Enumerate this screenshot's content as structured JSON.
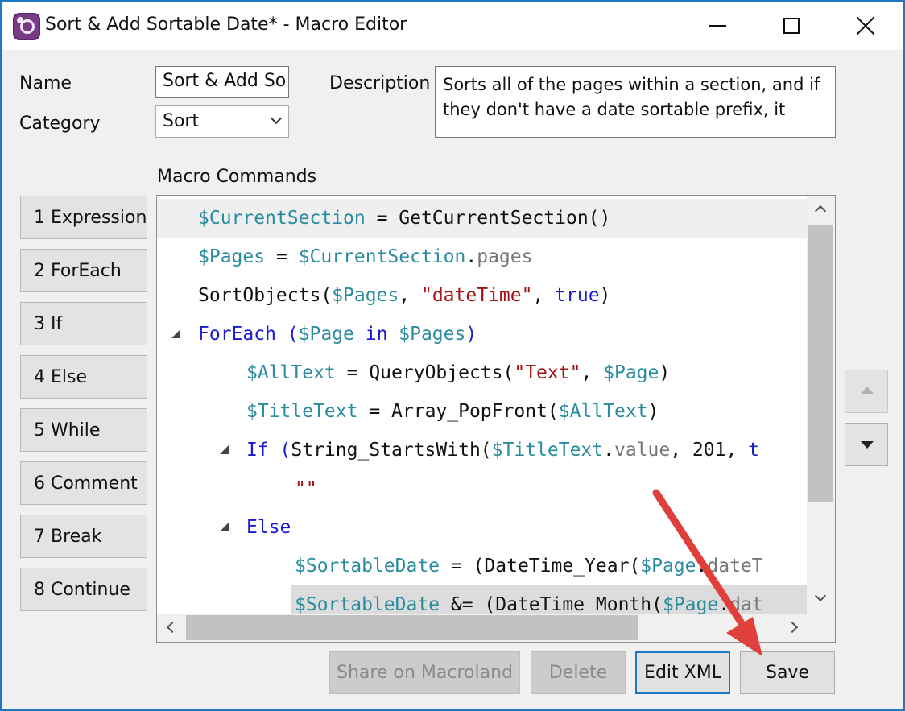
{
  "window": {
    "title": "Sort & Add Sortable Date* - Macro Editor",
    "icon": "onetastic-icon",
    "border_color": "#1e78c8"
  },
  "form": {
    "name_label": "Name",
    "name_value": "Sort & Add So",
    "category_label": "Category",
    "category_value": "Sort",
    "description_label": "Description",
    "description_value": "Sorts all of the pages within a section, and if they don't have a date sortable prefix, it",
    "commands_label": "Macro Commands"
  },
  "command_buttons": [
    "1 Expression",
    "2 ForEach",
    "3 If",
    "4 Else",
    "5 While",
    "6 Comment",
    "7 Break",
    "8 Continue"
  ],
  "code_lines": [
    {
      "indent": 0,
      "tokens": [
        [
          "v",
          "$CurrentSection"
        ],
        [
          "o",
          " = "
        ],
        [
          "f",
          "GetCurrentSection()"
        ]
      ]
    },
    {
      "indent": 0,
      "tokens": [
        [
          "v",
          "$Pages"
        ],
        [
          "o",
          " = "
        ],
        [
          "v",
          "$CurrentSection"
        ],
        [
          "o",
          "."
        ],
        [
          "p",
          "pages"
        ]
      ]
    },
    {
      "indent": 0,
      "tokens": [
        [
          "f",
          "SortObjects("
        ],
        [
          "v",
          "$Pages"
        ],
        [
          "o",
          ", "
        ],
        [
          "s",
          "\"dateTime\""
        ],
        [
          "o",
          ", "
        ],
        [
          "k",
          "true"
        ],
        [
          "o",
          ")"
        ]
      ]
    },
    {
      "indent": 0,
      "collapse": true,
      "tokens": [
        [
          "k",
          "ForEach ("
        ],
        [
          "v",
          "$Page"
        ],
        [
          "k",
          " in "
        ],
        [
          "v",
          "$Pages"
        ],
        [
          "k",
          ")"
        ]
      ]
    },
    {
      "indent": 1,
      "tokens": [
        [
          "v",
          "$AllText"
        ],
        [
          "o",
          " = "
        ],
        [
          "f",
          "QueryObjects("
        ],
        [
          "s",
          "\"Text\""
        ],
        [
          "o",
          ", "
        ],
        [
          "v",
          "$Page"
        ],
        [
          "o",
          ")"
        ]
      ]
    },
    {
      "indent": 1,
      "tokens": [
        [
          "v",
          "$TitleText"
        ],
        [
          "o",
          " = "
        ],
        [
          "f",
          "Array_PopFront("
        ],
        [
          "v",
          "$AllText"
        ],
        [
          "o",
          ")"
        ]
      ]
    },
    {
      "indent": 1,
      "collapse": true,
      "tokens": [
        [
          "k",
          "If ("
        ],
        [
          "f",
          "String_StartsWith("
        ],
        [
          "v",
          "$TitleText"
        ],
        [
          "o",
          "."
        ],
        [
          "p",
          "value"
        ],
        [
          "o",
          ", 201, "
        ],
        [
          "k",
          "t"
        ]
      ]
    },
    {
      "indent": 2,
      "tokens": [
        [
          "s",
          "\"\""
        ]
      ]
    },
    {
      "indent": 1,
      "collapse": true,
      "tokens": [
        [
          "k",
          "Else"
        ]
      ]
    },
    {
      "indent": 2,
      "tokens": [
        [
          "v",
          "$SortableDate"
        ],
        [
          "o",
          " = (DateTime_Year("
        ],
        [
          "v",
          "$Page"
        ],
        [
          "o",
          "."
        ],
        [
          "p",
          "dateT"
        ]
      ]
    },
    {
      "indent": 2,
      "tokens": [
        [
          "v",
          "$SortableDate"
        ],
        [
          "o",
          " &= (DateTime_Month("
        ],
        [
          "v",
          "$Page"
        ],
        [
          "o",
          "."
        ],
        [
          "p",
          "dat"
        ]
      ]
    }
  ],
  "buttons": {
    "share": "Share on Macroland",
    "delete": "Delete",
    "edit_xml": "Edit XML",
    "save": "Save"
  },
  "icons": {
    "move_up": "arrow-up-icon",
    "move_down": "arrow-down-icon"
  },
  "annotation": {
    "arrow_color": "#e0403c",
    "target": "save-button"
  }
}
